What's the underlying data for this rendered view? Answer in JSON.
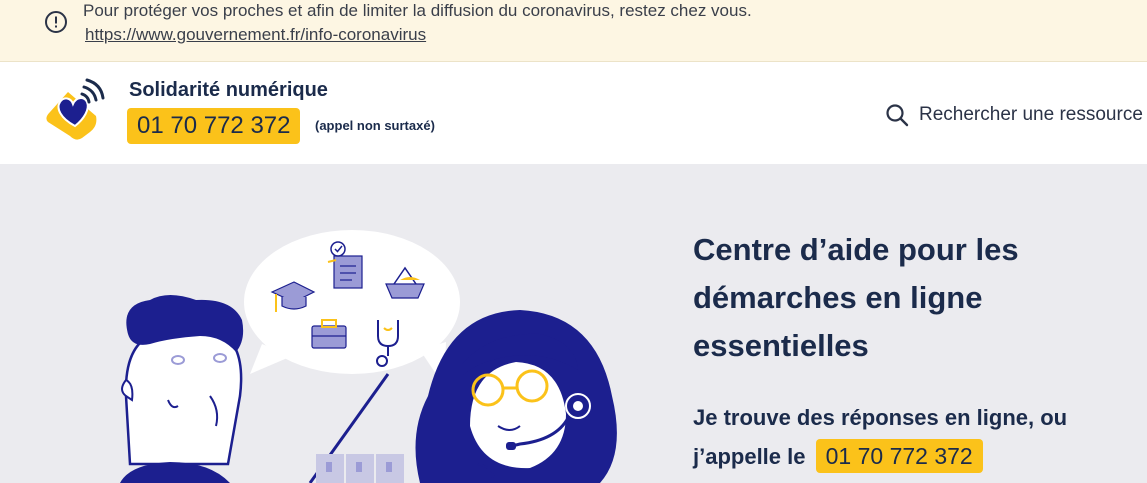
{
  "banner": {
    "message": "Pour protéger vos proches et afin de limiter la diffusion du coronavirus, restez chez vous.",
    "link": "https://www.gouvernement.fr/info-coronavirus",
    "icon": "alert-circle-icon"
  },
  "header": {
    "site_title": "Solidarité numérique",
    "phone": "01 70 772 372",
    "phone_note": "(appel non surtaxé)",
    "search_label": "Rechercher une ressource",
    "search_icon": "search-icon"
  },
  "hero": {
    "title": "Centre d’aide pour les démarches en ligne essentielles",
    "subtitle": "Je trouve des réponses en ligne, ou j’appelle le",
    "phone": "01 70 772 372"
  },
  "colors": {
    "navy": "#1b2b4b",
    "accent_yellow": "#fbc21a",
    "banner_bg": "#fdf6e3",
    "hero_bg": "#ebebef",
    "illustration_blue": "#1c1f8f",
    "illustration_lavender": "#9b9bd6"
  }
}
